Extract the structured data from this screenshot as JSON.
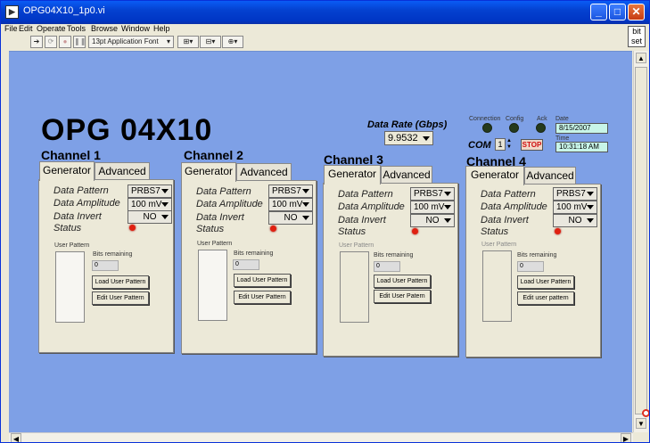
{
  "window": {
    "title": "OPG04X10_1p0.vi",
    "title_icon": "vi-icon",
    "minimize_label": "_",
    "maximize_label": "□",
    "close_label": "✕"
  },
  "menu": [
    "File",
    "Edit",
    "Operate",
    "Tools",
    "Browse",
    "Window",
    "Help"
  ],
  "toolbar": {
    "font_select": "13pt Application Font",
    "bitset": [
      "bit",
      "set"
    ]
  },
  "front_panel": {
    "title": "OPG  04X10",
    "data_rate_label": "Data Rate (Gbps)",
    "data_rate_value": "9.9532",
    "indicators": {
      "connection": "Connection",
      "config": "Config",
      "ack": "Ack",
      "date_label": "Date",
      "date_value": "8/15/2007",
      "time_label": "Time",
      "time_value": "10:31:18 AM"
    },
    "com_label": "COM",
    "com_value": "1",
    "stop_label": "STOP",
    "channels": [
      {
        "name": "Channel 1",
        "tabs": [
          "Generator",
          "Advanced"
        ],
        "data_pattern_label": "Data Pattern",
        "data_pattern": "PRBS7",
        "amplitude_label": "Data Amplitude",
        "amplitude": "100 mV",
        "invert_label": "Data Invert",
        "invert": "NO",
        "status_label": "Status",
        "user_pattern_label": "User Pattern",
        "bits_remaining_label": "Bits remaining",
        "bits_remaining": "0",
        "load_button": "Load User Pattern",
        "edit_button": "Edit User Pattern"
      },
      {
        "name": "Channel 2",
        "tabs": [
          "Generator",
          "Advanced"
        ],
        "data_pattern_label": "Data Pattern",
        "data_pattern": "PRBS7",
        "amplitude_label": "Data Amplitude",
        "amplitude": "100 mV",
        "invert_label": "Data Invert",
        "invert": "NO",
        "status_label": "Status",
        "user_pattern_label": "User Pattern",
        "bits_remaining_label": "Bits remaining",
        "bits_remaining": "0",
        "load_button": "Load User Pattern",
        "edit_button": "Edit User Pattern"
      },
      {
        "name": "Channel 3",
        "tabs": [
          "Generator",
          "Advanced"
        ],
        "data_pattern_label": "Data Pattern",
        "data_pattern": "PRBS7",
        "amplitude_label": "Data Amplitude",
        "amplitude": "100 mV",
        "invert_label": "Data Invert",
        "invert": "NO",
        "status_label": "Status",
        "user_pattern_label": "User Pattern",
        "bits_remaining_label": "Bits remaining",
        "bits_remaining": "0",
        "load_button": "Load User Pattern",
        "edit_button": "Edit User Patern"
      },
      {
        "name": "Channel 4",
        "tabs": [
          "Generator",
          "Advanced"
        ],
        "data_pattern_label": "Data Pattern",
        "data_pattern": "PRBS7",
        "amplitude_label": "Data Amplitude",
        "amplitude": "100 mV",
        "invert_label": "Data Invert",
        "invert": "NO",
        "status_label": "Status",
        "user_pattern_label": "User Pattern",
        "bits_remaining_label": "Bits remaining",
        "bits_remaining": "0",
        "load_button": "Load User Pattern",
        "edit_button": "Edit user pattern"
      }
    ]
  },
  "colors": {
    "panel_bg": "#7ea0e6",
    "status_led": "#e02010",
    "indicator_led_off": "#253a1c",
    "time_box": "#c8f5e8"
  }
}
